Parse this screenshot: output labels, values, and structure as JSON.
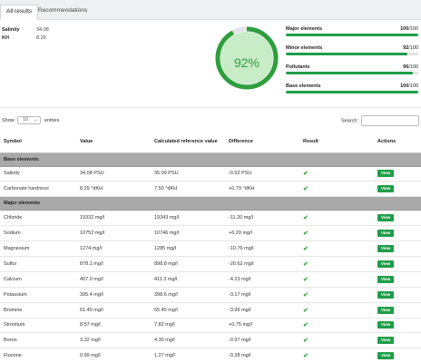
{
  "tabs": [
    {
      "label": "All results"
    },
    {
      "label": "Recommendations"
    }
  ],
  "summary": {
    "salinity_label": "Salinity",
    "salinity_value": "34.08",
    "kh_label": "KH",
    "kh_value": "8.29"
  },
  "score": {
    "value_text": "92%",
    "value": 92,
    "color": "#2e9e3d"
  },
  "categories": [
    {
      "label": "Major elements",
      "score": "100",
      "max": "/100",
      "value": 100
    },
    {
      "label": "Minor elements",
      "score": "92",
      "max": "/100",
      "value": 92
    },
    {
      "label": "Pollutants",
      "score": "96",
      "max": "/100",
      "value": 96
    },
    {
      "label": "Base elements",
      "score": "100",
      "max": "/100",
      "value": 100
    }
  ],
  "table_controls": {
    "show_label": "Show",
    "entries_value": "10",
    "entries_label": "entries",
    "search_label": "Search:"
  },
  "columns": [
    "Symbol",
    "Value",
    "Calculated reference value",
    "Difference",
    "Result",
    "Actions"
  ],
  "groups": [
    {
      "title": "Base elements",
      "rows": [
        {
          "symbol": "Salinity",
          "value": "34.08 PSU",
          "reference": "35.00 PSU",
          "difference": "-0.92 PSU"
        },
        {
          "symbol": "Carbonate hardness",
          "value": "8.29 °dKH",
          "reference": "7.50 °dKH",
          "difference": "+0.79 °dKH"
        }
      ]
    },
    {
      "title": "Major elements",
      "rows": [
        {
          "symbol": "Chloride",
          "value": "19332 mg/l",
          "reference": "19343 mg/l",
          "difference": "-11.20 mg/l"
        },
        {
          "symbol": "Sodium",
          "value": "10752 mg/l",
          "reference": "10746 mg/l",
          "difference": "+6.20 mg/l"
        },
        {
          "symbol": "Magnesium",
          "value": "1274 mg/l",
          "reference": "1285 mg/l",
          "difference": "-10.76 mg/l"
        },
        {
          "symbol": "Sulfur",
          "value": "878.1 mg/l",
          "reference": "898.8 mg/l",
          "difference": "-20.62 mg/l"
        },
        {
          "symbol": "Calcium",
          "value": "407.0 mg/l",
          "reference": "411.3 mg/l",
          "difference": "-4.23 mg/l"
        },
        {
          "symbol": "Potassium",
          "value": "395.4 mg/l",
          "reference": "398.6 mg/l",
          "difference": "-3.17 mg/l"
        },
        {
          "symbol": "Bromine",
          "value": "61.49 mg/l",
          "reference": "65.45 mg/l",
          "difference": "-3.96 mg/l"
        },
        {
          "symbol": "Strontium",
          "value": "8.57 mg/l",
          "reference": "7.82 mg/l",
          "difference": "+0.75 mg/l"
        },
        {
          "symbol": "Boron",
          "value": "3.32 mg/l",
          "reference": "4.30 mg/l",
          "difference": "-0.97 mg/l"
        },
        {
          "symbol": "Fluorine",
          "value": "0.99 mg/l",
          "reference": "1.27 mg/l",
          "difference": "-0.28 mg/l"
        }
      ]
    }
  ],
  "result_icon": "check-icon",
  "action_label": "View",
  "colors": {
    "accent_green": "#1f9d48",
    "check_green": "#35a845",
    "group_header": "#a9a9a9"
  }
}
